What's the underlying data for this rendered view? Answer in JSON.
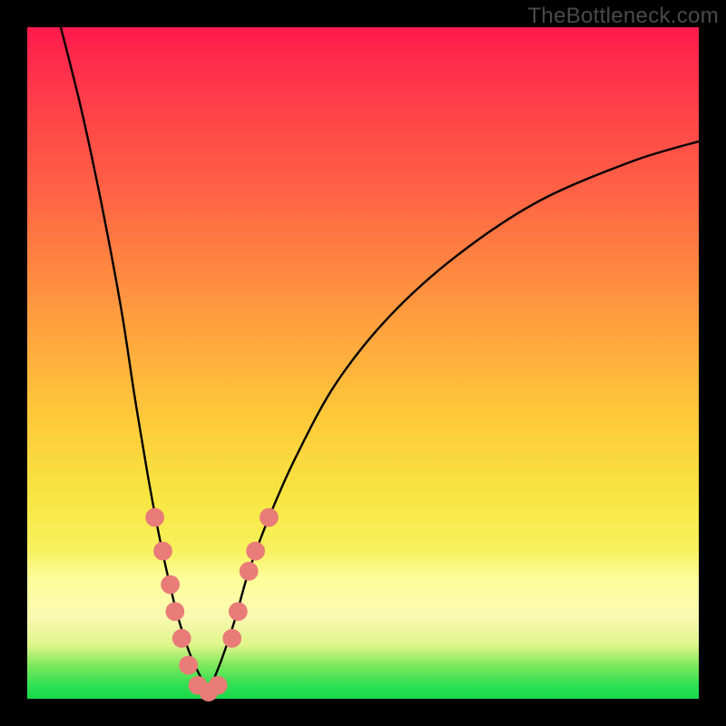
{
  "watermark": "TheBottleneck.com",
  "chart_data": {
    "type": "line",
    "title": "",
    "xlabel": "",
    "ylabel": "",
    "xlim": [
      0,
      100
    ],
    "ylim": [
      0,
      100
    ],
    "grid": false,
    "legend": false,
    "background_gradient": {
      "stops": [
        {
          "pct": 0,
          "color": "#ff1a4d"
        },
        {
          "pct": 26,
          "color": "#ff6744"
        },
        {
          "pct": 58,
          "color": "#ffc93a"
        },
        {
          "pct": 82,
          "color": "#fdfd9a"
        },
        {
          "pct": 95,
          "color": "#7fe85c"
        },
        {
          "pct": 100,
          "color": "#18d94c"
        }
      ]
    },
    "series": [
      {
        "name": "left-curve",
        "x": [
          5,
          8,
          11,
          14,
          16,
          18,
          19.5,
          21,
          22.5,
          24.5,
          27
        ],
        "y": [
          100,
          88,
          74,
          58,
          45,
          33,
          25,
          18,
          12,
          6,
          1
        ]
      },
      {
        "name": "right-curve",
        "x": [
          27,
          29,
          31,
          33,
          36,
          40,
          46,
          54,
          64,
          76,
          90,
          100
        ],
        "y": [
          1,
          6,
          12,
          19,
          27,
          36,
          47,
          57,
          66,
          74,
          80,
          83
        ]
      }
    ],
    "markers": {
      "name": "pink-dots",
      "color": "#e97b78",
      "points": [
        {
          "x": 19.0,
          "y": 27
        },
        {
          "x": 20.2,
          "y": 22
        },
        {
          "x": 21.3,
          "y": 17
        },
        {
          "x": 22.0,
          "y": 13
        },
        {
          "x": 23.0,
          "y": 9
        },
        {
          "x": 24.0,
          "y": 5
        },
        {
          "x": 25.4,
          "y": 2
        },
        {
          "x": 27.0,
          "y": 1
        },
        {
          "x": 28.4,
          "y": 2
        },
        {
          "x": 30.5,
          "y": 9
        },
        {
          "x": 31.4,
          "y": 13
        },
        {
          "x": 33.0,
          "y": 19
        },
        {
          "x": 34.0,
          "y": 22
        },
        {
          "x": 36.0,
          "y": 27
        }
      ]
    }
  }
}
